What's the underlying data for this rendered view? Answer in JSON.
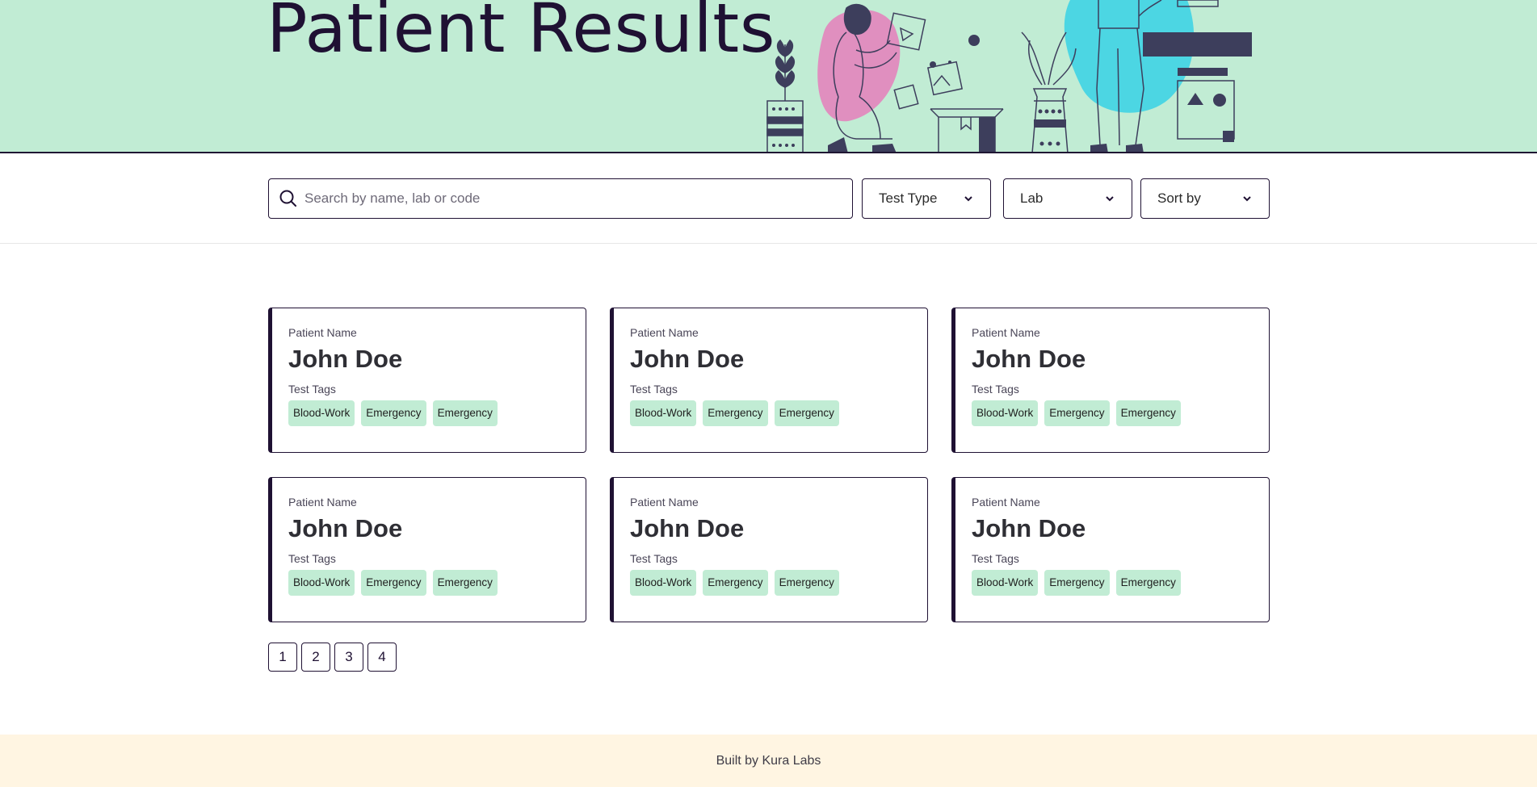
{
  "hero": {
    "title": "Patient Results",
    "bg_color": "#c1ecd4"
  },
  "search": {
    "placeholder": "Search by name, lab or code",
    "value": ""
  },
  "filters": {
    "test_type": "Test Type",
    "lab": "Lab",
    "sort_by": "Sort by"
  },
  "cards": [
    {
      "label": "Patient Name",
      "name": "John Doe",
      "tags_label": "Test Tags",
      "tags": [
        "Blood-Work",
        "Emergency",
        "Emergency"
      ]
    },
    {
      "label": "Patient Name",
      "name": "John Doe",
      "tags_label": "Test Tags",
      "tags": [
        "Blood-Work",
        "Emergency",
        "Emergency"
      ]
    },
    {
      "label": "Patient Name",
      "name": "John Doe",
      "tags_label": "Test Tags",
      "tags": [
        "Blood-Work",
        "Emergency",
        "Emergency"
      ]
    },
    {
      "label": "Patient Name",
      "name": "John Doe",
      "tags_label": "Test Tags",
      "tags": [
        "Blood-Work",
        "Emergency",
        "Emergency"
      ]
    },
    {
      "label": "Patient Name",
      "name": "John Doe",
      "tags_label": "Test Tags",
      "tags": [
        "Blood-Work",
        "Emergency",
        "Emergency"
      ]
    },
    {
      "label": "Patient Name",
      "name": "John Doe",
      "tags_label": "Test Tags",
      "tags": [
        "Blood-Work",
        "Emergency",
        "Emergency"
      ]
    }
  ],
  "pagination": {
    "pages": [
      "1",
      "2",
      "3",
      "4"
    ]
  },
  "footer": {
    "text": "Built by Kura Labs",
    "bg_color": "#fff5e2"
  },
  "colors": {
    "accent_dark": "#1f1133",
    "tag_bg": "#c1ecd4",
    "illustration_pink": "#e08fbf",
    "illustration_cyan": "#4cd6e3",
    "illustration_navy": "#3d3e5c"
  }
}
